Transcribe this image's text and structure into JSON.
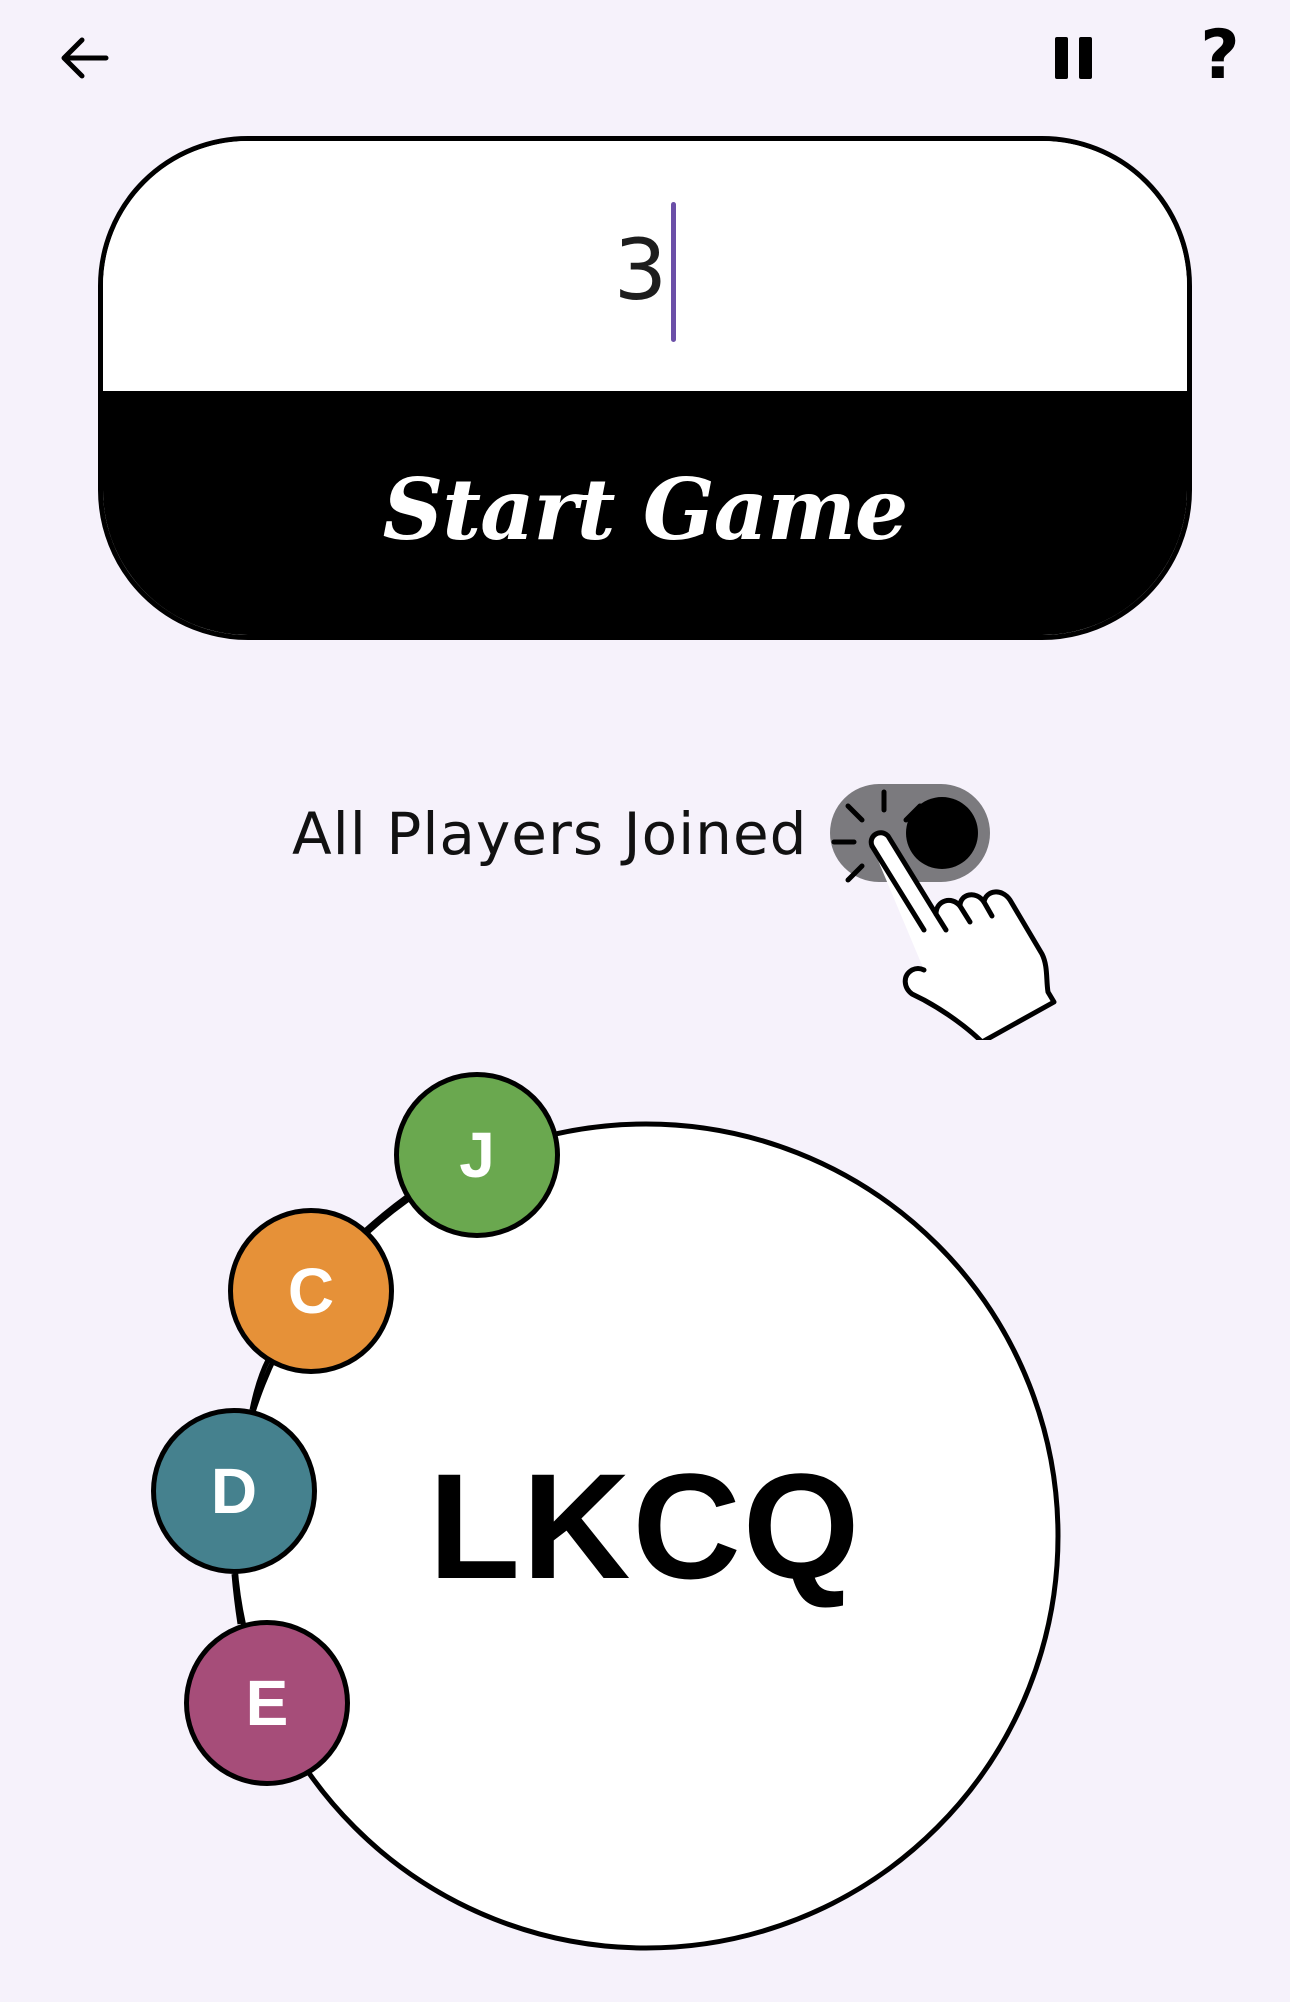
{
  "header": {
    "back_icon": "arrow-left-icon",
    "pause_icon": "pause-icon",
    "help_icon": "question-mark-icon",
    "help_glyph": "?"
  },
  "game_card": {
    "player_count_value": "3",
    "start_label": "Start Game"
  },
  "joined": {
    "label": "All Players Joined",
    "toggle_on": true,
    "hint_icon": "tap-hand-icon"
  },
  "room": {
    "code": "LKCQ",
    "players": [
      {
        "initial": "J",
        "color": "#6aa84f"
      },
      {
        "initial": "C",
        "color": "#e69138"
      },
      {
        "initial": "D",
        "color": "#45818e"
      },
      {
        "initial": "E",
        "color": "#a64d79"
      }
    ]
  }
}
